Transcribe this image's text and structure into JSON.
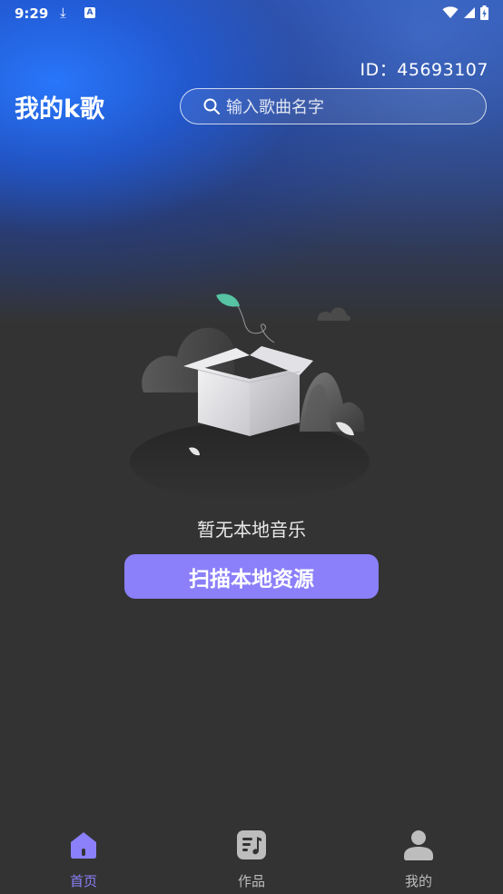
{
  "status_bar": {
    "time": "9:29",
    "download_glyph": "⤓",
    "a_glyph": "A"
  },
  "header": {
    "user_id": "ID：45693107",
    "title": "我的k歌",
    "search_placeholder": "输入歌曲名字"
  },
  "empty_state": {
    "message": "暂无本地音乐",
    "scan_button_label": "扫描本地资源"
  },
  "bottom_nav": {
    "items": [
      {
        "label": "首页",
        "icon": "home-icon",
        "active": true
      },
      {
        "label": "作品",
        "icon": "music-note-icon",
        "active": false
      },
      {
        "label": "我的",
        "icon": "user-icon",
        "active": false
      }
    ]
  },
  "colors": {
    "accent": "#8b80f9",
    "background": "#333333",
    "header_blue": "#2f5fc4",
    "nav_inactive": "#bdbdbd"
  }
}
